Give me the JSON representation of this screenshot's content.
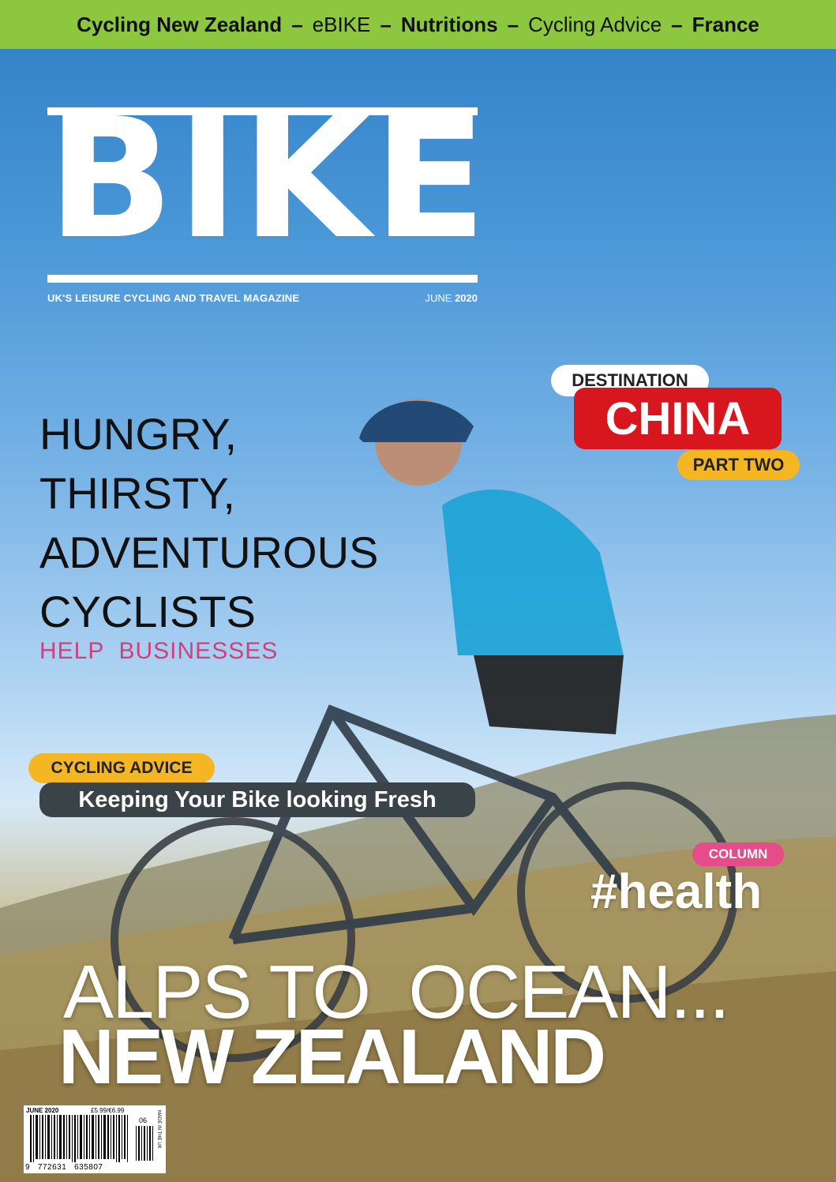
{
  "topbar": {
    "item1": "Cycling New Zealand",
    "item2": "eBIKE",
    "item3": "Nutritions",
    "item4": "Cycling Advice",
    "item5": "France",
    "separator": "–"
  },
  "masthead": {
    "logo": "BIKE",
    "tagline": "UK'S LEISURE CYCLING AND TRAVEL MAGAZINE",
    "issue_month": "JUNE",
    "issue_year": "2020"
  },
  "destination": {
    "tag": "DESTINATION",
    "title": "CHINA",
    "part": "PART TWO"
  },
  "feature": {
    "line1": "HUNGRY,",
    "line2": "THIRSTY,",
    "line3": "ADVENTUROUS",
    "line4": "CYCLISTS",
    "sub": "HELP  BUSINESSES"
  },
  "advice": {
    "tag": "CYCLING ADVICE",
    "title": "Keeping Your Bike looking Fresh"
  },
  "column": {
    "tag": "COLUMN",
    "title": "#health"
  },
  "cover_story": {
    "line1": "ALPS TO  OCEAN...",
    "line2": "NEW ZEALAND"
  },
  "barcode": {
    "date": "JUNE 2020",
    "price": "£5.99/€6.99",
    "edition": "06",
    "number": "9   772631   635807",
    "made_in": "MADE IN THE UK"
  },
  "colors": {
    "topbar": "#8dc63f",
    "china_red": "#d7161e",
    "yellow_tag": "#f5b623",
    "pink": "#d23f7a",
    "advice_bar": "#3a4448"
  }
}
